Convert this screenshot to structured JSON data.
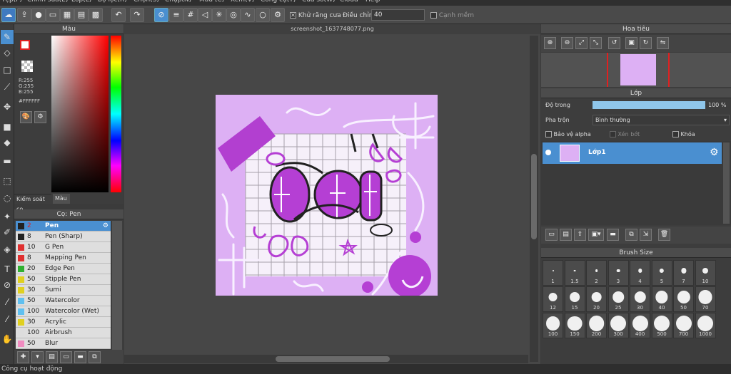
{
  "menu": [
    "Tệp(F)",
    "Chỉnh sửa(E)",
    "Lớp(L)",
    "Bộ lọc(R)",
    "Chọn(S)",
    "Chụp(N)",
    "Màu (C)",
    "Xem(V)",
    "Công cụ(T)",
    "Cửa sổ(W)",
    "Cloud",
    "Help"
  ],
  "toolbar": {
    "antialias_label": "Khử răng cưa",
    "adjust_label": "Điều chỉnh",
    "adjust_value": "40",
    "edge_label": "Cạnh mềm"
  },
  "color_panel": {
    "title": "Màu",
    "r": "R:255",
    "g": "G:255",
    "b": "B:255",
    "hex": "#FFFFFF",
    "tab1": "Kiểm soát cọ",
    "tab2": "Màu"
  },
  "brush_panel": {
    "title": "Cọ: Pen",
    "items": [
      {
        "size": "2",
        "name": "Pen",
        "color": "#222222"
      },
      {
        "size": "8",
        "name": "Pen (Sharp)",
        "color": "#222222"
      },
      {
        "size": "10",
        "name": "G Pen",
        "color": "#e03030"
      },
      {
        "size": "8",
        "name": "Mapping Pen",
        "color": "#e03030"
      },
      {
        "size": "20",
        "name": "Edge Pen",
        "color": "#30b030"
      },
      {
        "size": "50",
        "name": "Stipple Pen",
        "color": "#e0d020"
      },
      {
        "size": "30",
        "name": "Sumi",
        "color": "#e0d020"
      },
      {
        "size": "50",
        "name": "Watercolor",
        "color": "#60c0f0"
      },
      {
        "size": "100",
        "name": "Watercolor (Wet)",
        "color": "#60c0f0"
      },
      {
        "size": "30",
        "name": "Acrylic",
        "color": "#e0d020"
      },
      {
        "size": "100",
        "name": "Airbrush",
        "color": "#dddddd"
      },
      {
        "size": "50",
        "name": "Blur",
        "color": "#f08cc0"
      }
    ]
  },
  "canvas": {
    "tab_title": "screenshot_1637748077.png"
  },
  "navigator": {
    "title": "Hoa tiêu"
  },
  "layer_panel": {
    "title": "Lớp",
    "opacity_label": "Độ trong",
    "opacity_value": "100 %",
    "opacity_fraction": 1.0,
    "blend_label": "Pha trộn",
    "blend_value": "Bình thường",
    "protect_alpha": "Bảo vệ alpha",
    "clipping": "Xén bớt",
    "lock": "Khóa",
    "layer_name": "Lớp1"
  },
  "brush_size": {
    "title": "Brush Size",
    "sizes": [
      "1",
      "1.5",
      "2",
      "3",
      "4",
      "5",
      "7",
      "10",
      "12",
      "15",
      "20",
      "25",
      "30",
      "40",
      "50",
      "70",
      "100",
      "150",
      "200",
      "300",
      "400",
      "500",
      "700",
      "1000"
    ]
  },
  "status": "Công cụ hoạt động",
  "colors": {
    "accent": "#4a8fd0",
    "canvas_bg": "#ddb0f4",
    "layer_sel": "#4a8fd0"
  }
}
